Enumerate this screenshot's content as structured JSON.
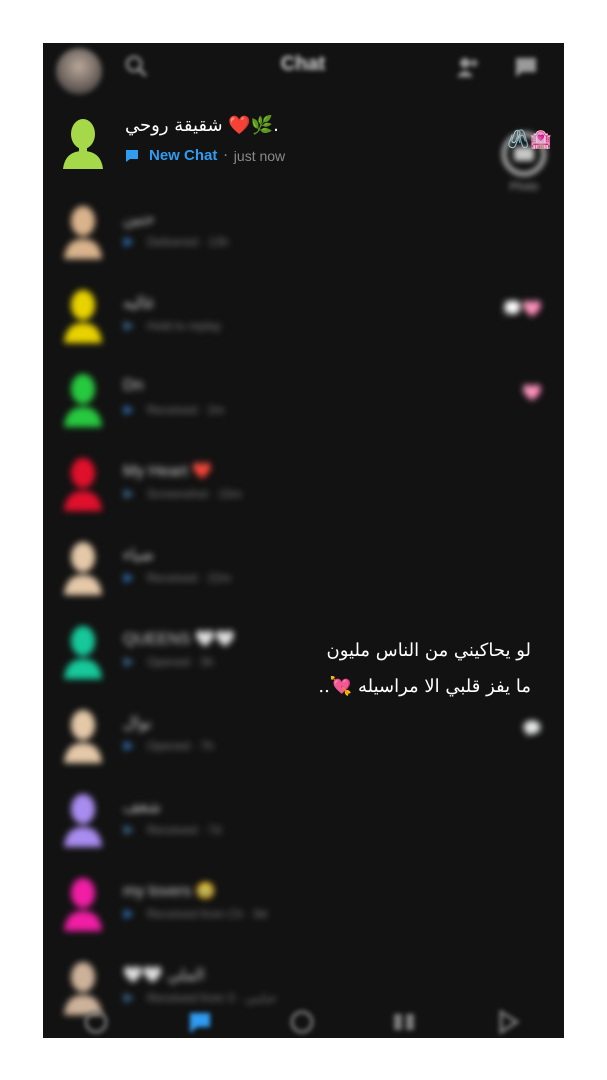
{
  "header": {
    "title": "Chat",
    "icons": [
      "profile-avatar",
      "search-icon",
      "add-friend-icon",
      "new-chat-icon"
    ]
  },
  "top_chat": {
    "name": "شقيقة روحي ❤️🌿.",
    "status_label": "New Chat",
    "separator": "·",
    "time": "just now",
    "right_emojis": "🖇️🏩"
  },
  "blurred_rows": [
    {
      "name": "حنين",
      "sub": "Delivered · 13h",
      "color": "#d9b38c",
      "right": ""
    },
    {
      "name": "غاليه",
      "sub": "Hold to replay",
      "color": "#e8d200",
      "right": "💭🩷"
    },
    {
      "name": "Dn",
      "sub": "Received · 2m",
      "color": "#27c93f",
      "right": "🩷"
    },
    {
      "name": "My Heart ❤️",
      "sub": "Screenshot · 15m",
      "color": "#e0102c",
      "right": ""
    },
    {
      "name": "ضياء",
      "sub": "Received · 22m",
      "color": "#e4c8a8",
      "right": ""
    },
    {
      "name": "QUEENS 🤍🤍",
      "sub": "Opened · 3h",
      "color": "#16c89a",
      "right": ""
    },
    {
      "name": "نوال",
      "sub": "Opened · 7h",
      "color": "#e4c8a8",
      "right": "💬"
    },
    {
      "name": "شغف",
      "sub": "Received · 7d",
      "color": "#a98cf0",
      "right": ""
    },
    {
      "name": "my lovers 🥹",
      "sub": "Received from Ch · 9d",
      "color": "#f01ea4",
      "right": ""
    },
    {
      "name": "🤍🤍 الملي",
      "sub": "Received from 3 · حبايبي",
      "color": "#cdb29a",
      "right": ""
    }
  ],
  "camera_label": "Photo",
  "caption": {
    "line1": "لو يحاكيني من الناس مليون",
    "line2": "ما يفز قلبي الا مراسيله 💘.."
  },
  "bottom_nav": [
    "map-icon",
    "chat-icon",
    "camera-icon",
    "stories-icon",
    "spotlight-icon"
  ],
  "colors": {
    "background": "#121212",
    "accent_blue": "#2f9bf1",
    "bitmoji_green": "#a5d94a"
  }
}
